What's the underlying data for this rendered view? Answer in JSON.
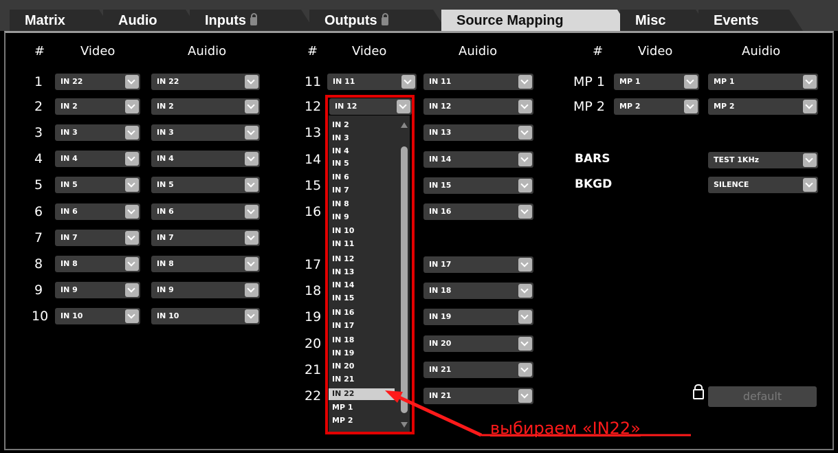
{
  "tabs": [
    {
      "label": "Matrix",
      "lock": false
    },
    {
      "label": "Audio",
      "lock": false
    },
    {
      "label": "Inputs",
      "lock": true
    },
    {
      "label": "Outputs",
      "lock": true
    },
    {
      "label": "Source Mapping",
      "lock": false,
      "active": true
    },
    {
      "label": "Misc",
      "lock": false
    },
    {
      "label": "Events",
      "lock": false
    }
  ],
  "headers": {
    "num": "#",
    "video": "Video",
    "audio": "Auidio"
  },
  "col1": [
    {
      "num": "1",
      "video": "IN 22",
      "audio": "IN 22"
    },
    {
      "num": "2",
      "video": "IN 2",
      "audio": "IN 2"
    },
    {
      "num": "3",
      "video": "IN 3",
      "audio": "IN 3"
    },
    {
      "num": "4",
      "video": "IN 4",
      "audio": "IN 4"
    },
    {
      "num": "5",
      "video": "IN 5",
      "audio": "IN 5"
    },
    {
      "num": "6",
      "video": "IN 6",
      "audio": "IN 6"
    },
    {
      "num": "7",
      "video": "IN 7",
      "audio": "IN 7"
    },
    {
      "num": "8",
      "video": "IN 8",
      "audio": "IN 8"
    },
    {
      "num": "9",
      "video": "IN 9",
      "audio": "IN 9"
    },
    {
      "num": "10",
      "video": "IN 10",
      "audio": "IN 10"
    }
  ],
  "col2": [
    {
      "num": "11",
      "video": "IN 11",
      "audio": "IN 11"
    },
    {
      "num": "12",
      "video": "IN 12",
      "audio": "IN 12"
    },
    {
      "num": "13",
      "audio": "IN 13"
    },
    {
      "num": "14",
      "audio": "IN 14"
    },
    {
      "num": "15",
      "audio": "IN 15"
    },
    {
      "num": "16",
      "audio": "IN 16"
    },
    {
      "num": "17",
      "audio": "IN 17"
    },
    {
      "num": "18",
      "audio": "IN 18"
    },
    {
      "num": "19",
      "audio": "IN 19"
    },
    {
      "num": "20",
      "audio": "IN 20"
    },
    {
      "num": "21",
      "audio": "IN 21"
    },
    {
      "num": "22",
      "audio": "IN 21"
    }
  ],
  "dropdown_list": [
    "IN 2",
    "IN 3",
    "IN 4",
    "IN 5",
    "IN 6",
    "IN 7",
    "IN 8",
    "IN 9",
    "IN 10",
    "IN 11",
    "IN 12",
    "IN 13",
    "IN 14",
    "IN 15",
    "IN 16",
    "IN 17",
    "IN 18",
    "IN 19",
    "IN 20",
    "IN 21"
  ],
  "dropdown_selected": "IN 22",
  "dropdown_tail": [
    "MP 1",
    "MP 2"
  ],
  "col3": [
    {
      "label": "MP 1",
      "video": "MP 1",
      "audio": "MP 1"
    },
    {
      "label": "MP 2",
      "video": "MP 2",
      "audio": "MP 2"
    }
  ],
  "bars": {
    "label": "BARS",
    "audio": "TEST 1KHz"
  },
  "bkgd": {
    "label": "BKGD",
    "audio": "SILENCE"
  },
  "default_label": "default",
  "annotation": "выбираем «IN22»",
  "colors": {
    "highlight": "#e30000",
    "annotation": "#ff1a1a"
  }
}
